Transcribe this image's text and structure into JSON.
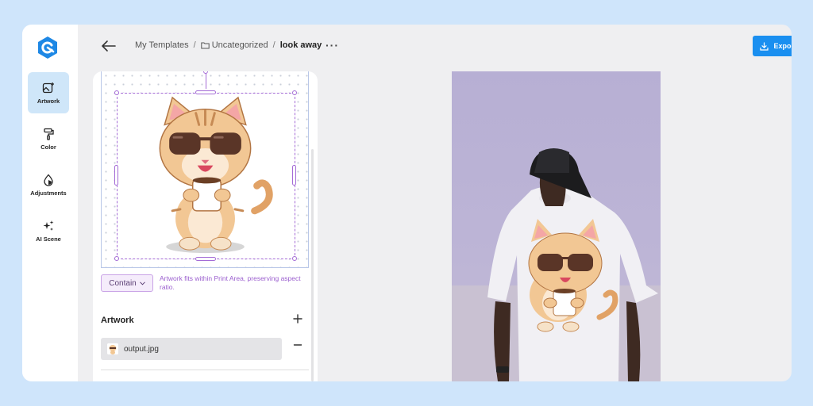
{
  "sidebar": {
    "items": [
      {
        "label": "Artwork",
        "icon": "image-plus-icon",
        "active": true
      },
      {
        "label": "Color",
        "icon": "paint-roller-icon",
        "active": false
      },
      {
        "label": "Adjustments",
        "icon": "droplet-icon",
        "active": false
      },
      {
        "label": "AI Scene",
        "icon": "sparkles-icon",
        "active": false
      }
    ]
  },
  "header": {
    "breadcrumb": [
      "My Templates",
      "Uncategorized",
      "look away"
    ],
    "more_label": "···",
    "export_label": "Export Mockups"
  },
  "editor": {
    "fit_mode": "Contain",
    "fit_note": "Artwork fits within Print Area, preserving aspect ratio.",
    "artwork_section_title": "Artwork",
    "files": [
      "output.jpg"
    ]
  },
  "colors": {
    "accent": "#1a8ff0",
    "selection": "#a46bd6",
    "active_nav": "#cfe6f9",
    "page_bg": "#cfe5fb"
  }
}
